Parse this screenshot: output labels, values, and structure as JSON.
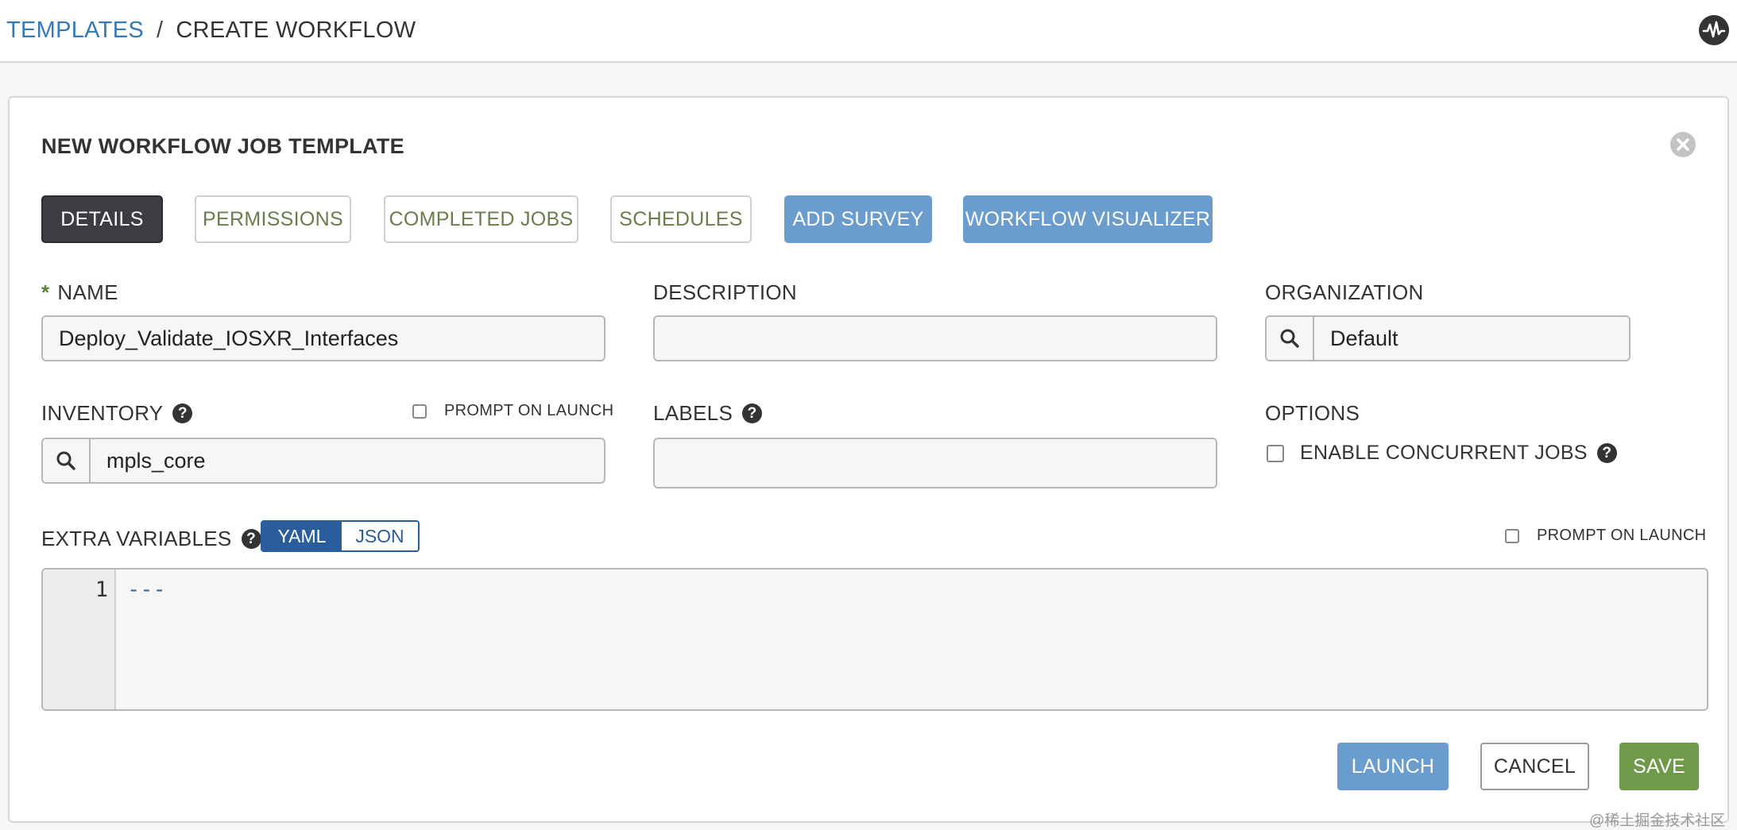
{
  "breadcrumb": {
    "root": "TEMPLATES",
    "separator": "/",
    "current": "CREATE WORKFLOW"
  },
  "header": {
    "activity_icon": "activity-pulse-icon"
  },
  "panel": {
    "title": "NEW WORKFLOW JOB TEMPLATE",
    "close_icon": "close-circle-icon"
  },
  "tabs": [
    {
      "label": "DETAILS",
      "state": "active"
    },
    {
      "label": "PERMISSIONS",
      "state": "default"
    },
    {
      "label": "COMPLETED JOBS",
      "state": "default"
    },
    {
      "label": "SCHEDULES",
      "state": "default"
    },
    {
      "label": "ADD SURVEY",
      "state": "primary"
    },
    {
      "label": "WORKFLOW VISUALIZER",
      "state": "primary"
    }
  ],
  "form": {
    "name": {
      "required_mark": "*",
      "label": "NAME",
      "value": "Deploy_Validate_IOSXR_Interfaces"
    },
    "description": {
      "label": "DESCRIPTION",
      "value": ""
    },
    "organization": {
      "label": "ORGANIZATION",
      "value": "Default"
    },
    "inventory": {
      "label": "INVENTORY",
      "help": "?",
      "value": "mpls_core",
      "prompt_on_launch": {
        "label": "PROMPT ON LAUNCH",
        "checked": false
      }
    },
    "labels": {
      "label": "LABELS",
      "help": "?",
      "value": ""
    },
    "options": {
      "label": "OPTIONS",
      "enable_concurrent_jobs": {
        "label": "ENABLE CONCURRENT JOBS",
        "help": "?",
        "checked": false
      }
    },
    "extra_variables": {
      "label": "EXTRA VARIABLES",
      "help": "?",
      "format_yaml": "YAML",
      "format_json": "JSON",
      "selected_format": "YAML",
      "prompt_on_launch": {
        "label": "PROMPT ON LAUNCH",
        "checked": false
      },
      "line_number": "1",
      "code": "---"
    }
  },
  "actions": {
    "launch": "LAUNCH",
    "cancel": "CANCEL",
    "save": "SAVE"
  },
  "colors": {
    "link": "#337ab7",
    "tab_active_bg": "#3b3d42",
    "primary_bg": "#6a9ccd",
    "save_bg": "#6f9a4a",
    "toggle_active": "#2b5d9c",
    "required": "#5e7f3b"
  },
  "watermark": "@稀土掘金技术社区"
}
